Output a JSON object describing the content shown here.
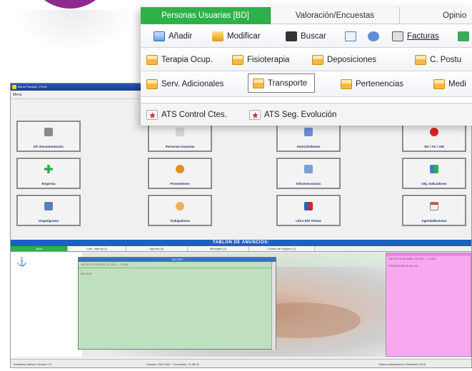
{
  "colors": {
    "accent_green": "#2fb14a",
    "title_blue": "#1e5fc4",
    "note_green": "#bfe0bf",
    "note_pink": "#f7a9f0",
    "brand_purple": "#8e2a8e"
  },
  "main_window": {
    "title": "Menú Principal - PXXX",
    "menu_label": "Menu",
    "buttons": [
      {
        "label": "Inf. Documentación",
        "icon": "document-icon"
      },
      {
        "label": "Personas Usuarias",
        "icon": "people-icon"
      },
      {
        "label": "Atención/Datos",
        "icon": "care-icon"
      },
      {
        "label": "NC / AC / AM",
        "icon": "no-entry-icon"
      },
      {
        "label": "Empresa",
        "icon": "plus-icon"
      },
      {
        "label": "Proveedores",
        "icon": "group-icon"
      },
      {
        "label": "Infraestructuras",
        "icon": "tools-icon"
      },
      {
        "label": "Obj. Indicadores",
        "icon": "chart-icon"
      },
      {
        "label": "Organigrama",
        "icon": "org-icon"
      },
      {
        "label": "Trabajadores",
        "icon": "worker-icon"
      },
      {
        "label": "Libro E/S Visitas",
        "icon": "book-icon"
      },
      {
        "label": "Agenda/Eventos",
        "icon": "calendar-icon"
      }
    ],
    "tablon_title": "TABLÓN DE ANUNCIOS:",
    "board_tabs": [
      {
        "label": "Inicio",
        "active": true
      },
      {
        "label": "Com. Interna (1)",
        "active": false
      },
      {
        "label": "Agenda (3)",
        "active": false
      },
      {
        "label": "Mensajes (2)",
        "active": false
      },
      {
        "label": "Control de Equipos (7)",
        "active": false
      }
    ],
    "green_note": {
      "title": "SALCINO",
      "date": "JUEVES 28 DE ABRIL DE 2016 — 13:08H",
      "body": "SALCINO"
    },
    "pink_note": {
      "date": "JUEVES 28 DE ABRIL DE 2016 — 13:08H",
      "body": "PROVEEDOR DE SILLAS"
    },
    "status": {
      "left": "Sanitaria-Calidad: Versión 2.5",
      "middle": "Usuario: SALCINO · Conectado: 11:38:42",
      "right": "Última Actualización: Diciembre 2016"
    }
  },
  "ribbon": {
    "tabs": [
      {
        "label": "Personas Usuarias [BD]",
        "active": true
      },
      {
        "label": "Valoración/Encuestas",
        "active": false
      },
      {
        "label": "Opinio",
        "active": false
      }
    ],
    "toolbar": [
      {
        "label": "Añadir",
        "icon": "add-document-icon"
      },
      {
        "label": "Modificar",
        "icon": "edit-icon"
      },
      {
        "label": "Buscar",
        "icon": "binoculars-icon"
      },
      {
        "label": "",
        "icon": "page-icon"
      },
      {
        "label": "",
        "icon": "link-icon"
      },
      {
        "label": "Facturas",
        "icon": "invoice-icon"
      }
    ],
    "row2": [
      {
        "label": "Terapia Ocup.",
        "icon": "folder-icon"
      },
      {
        "label": "Fisioterapia",
        "icon": "folder-icon"
      },
      {
        "label": "Deposiciones",
        "icon": "folder-icon"
      },
      {
        "label": "C. Postu",
        "icon": "folder-icon"
      }
    ],
    "row3": [
      {
        "label": "Serv. Adicionales",
        "icon": "folder-icon",
        "selected": false
      },
      {
        "label": "Transporte",
        "icon": "folder-icon",
        "selected": true
      },
      {
        "label": "Pertenencias",
        "icon": "folder-icon",
        "selected": false
      },
      {
        "label": "Medi",
        "icon": "folder-icon",
        "selected": false
      }
    ],
    "row4": [
      {
        "label": "ATS Control Ctes.",
        "icon": "red-star-icon"
      },
      {
        "label": "ATS Seg. Evolución",
        "icon": "red-star-icon"
      }
    ]
  }
}
